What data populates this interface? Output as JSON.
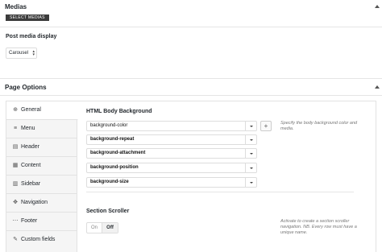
{
  "medias": {
    "title": "Medias",
    "select_button": "SELECT MEDIAS"
  },
  "post_media": {
    "label": "Post media display",
    "value": "Carousel"
  },
  "page_options": {
    "title": "Page Options",
    "tabs": [
      {
        "label": "General",
        "icon": "globe-icon",
        "active": true
      },
      {
        "label": "Menu",
        "icon": "menu-icon",
        "active": false
      },
      {
        "label": "Header",
        "icon": "header-icon",
        "active": false
      },
      {
        "label": "Content",
        "icon": "content-icon",
        "active": false
      },
      {
        "label": "Sidebar",
        "icon": "sidebar-icon",
        "active": false
      },
      {
        "label": "Navigation",
        "icon": "navigation-icon",
        "active": false
      },
      {
        "label": "Footer",
        "icon": "footer-icon",
        "active": false
      },
      {
        "label": "Custom fields",
        "icon": "brush-icon",
        "active": false
      }
    ],
    "html_body_background": {
      "title": "HTML Body Background",
      "help": "Specify the body background color and media.",
      "fields": [
        {
          "label": "background-color"
        },
        {
          "label": "background-repeat"
        },
        {
          "label": "background-attachment"
        },
        {
          "label": "background-position"
        },
        {
          "label": "background-size"
        }
      ],
      "add_label": "+"
    },
    "section_scroller": {
      "title": "Section Scroller",
      "help": "Activate to create a section scroller navigation. NB. Every row must have a unique name.",
      "on_label": "On",
      "off_label": "Off",
      "selected": "Off"
    }
  }
}
